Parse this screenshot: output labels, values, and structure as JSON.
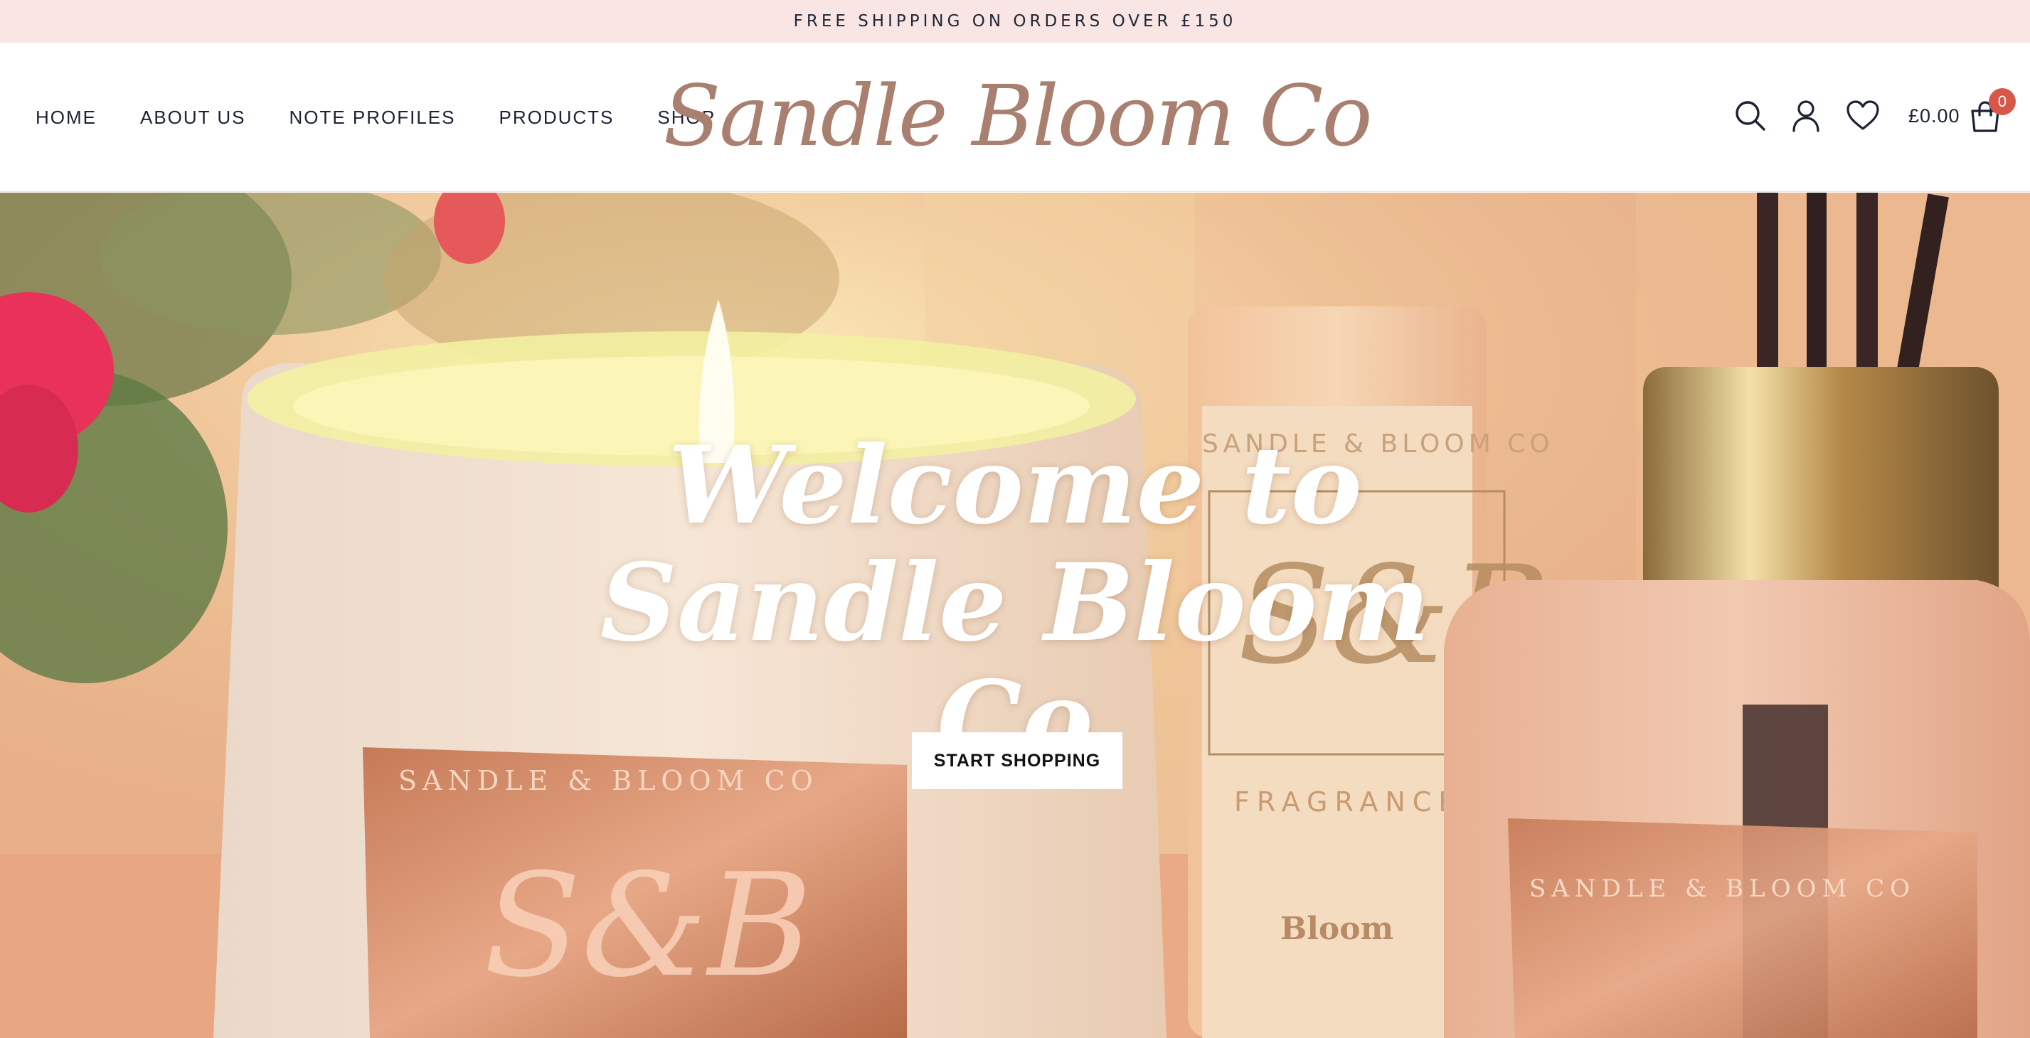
{
  "announcement": {
    "text": "FREE SHIPPING ON ORDERS OVER £150"
  },
  "nav": {
    "items": [
      {
        "label": "HOME"
      },
      {
        "label": "ABOUT US"
      },
      {
        "label": "NOTE PROFILES"
      },
      {
        "label": "PRODUCTS"
      },
      {
        "label": "SHOP"
      }
    ]
  },
  "logo": {
    "text": "Sandle Bloom Co"
  },
  "header_icons": {
    "search": "search-icon",
    "account": "user-icon",
    "wishlist": "heart-icon",
    "cart": "shopping-bag-icon",
    "cart_total": "£0.00",
    "cart_count": "0"
  },
  "hero": {
    "title_line1": "Welcome to",
    "title_line2": "Sandle Bloom Co",
    "cta_label": "START SHOPPING",
    "image": "candle-and-reed-diffuser-photo",
    "label_text_left": "SANDLE & BLOOM CO",
    "label_text_right": "SANDLE & BLOOM CO",
    "label_text_middle": "SANDLE & BLOOM CO",
    "monogram": "S&B",
    "jar_fragrance_text": "FRAGRANCE",
    "jar_product_name": "Bloom"
  },
  "colors": {
    "announcement_bg": "#f8e5e4",
    "logo": "#a98070",
    "nav_text": "#1c2233",
    "badge": "#d7574b",
    "cta_bg": "#ffffff"
  }
}
